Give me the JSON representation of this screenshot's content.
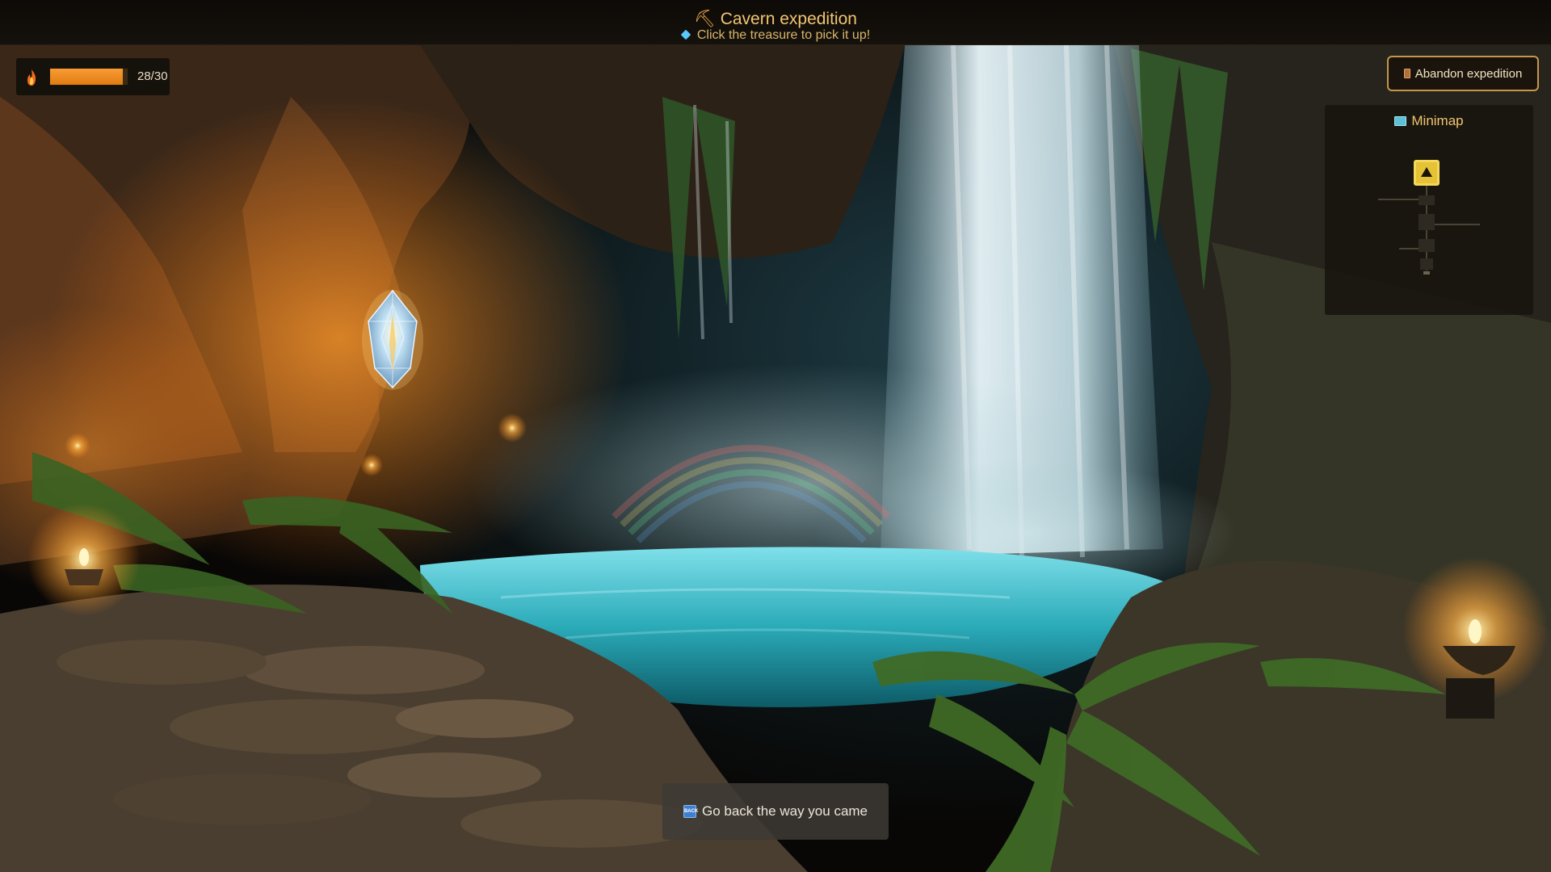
{
  "header": {
    "title": "Cavern expedition",
    "hint": "Click the treasure to pick it up!",
    "title_icon": "pickaxe-icon",
    "hint_icon": "gem-icon"
  },
  "torch": {
    "icon": "flame-icon",
    "fuel_current": 28,
    "fuel_max": 30,
    "fuel_text": "28/30",
    "fill_color": "#f39124"
  },
  "abandon": {
    "label": "Abandon expedition",
    "icon": "door-icon",
    "border_color": "#c5974d"
  },
  "minimap": {
    "title": "Minimap",
    "icon": "map-icon",
    "player_marker_icon": "triangle-up-icon",
    "marker_color": "#e5c236"
  },
  "treasure": {
    "icon": "crystal-icon"
  },
  "navigation": {
    "back_label": "Go back the way you came",
    "back_icon": "back-icon",
    "back_icon_text": "BACK"
  }
}
